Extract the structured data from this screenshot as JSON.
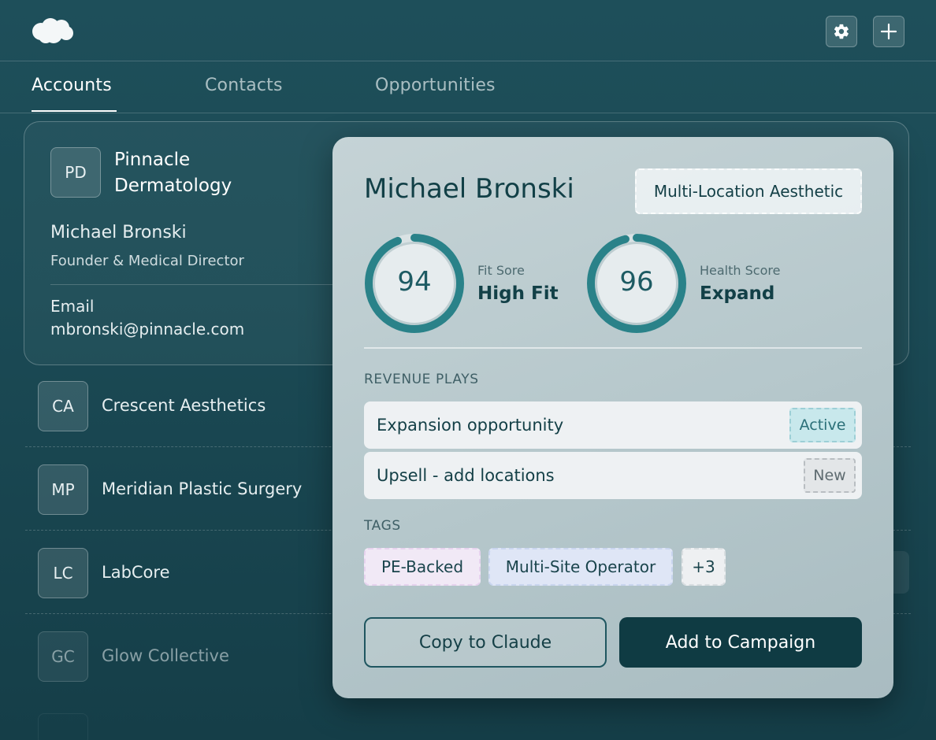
{
  "header": {
    "settings_icon": "gear-icon",
    "add_icon": "plus-icon",
    "logo_icon": "cloud-logo-icon"
  },
  "tabs": [
    {
      "label": "Accounts",
      "active": true
    },
    {
      "label": "Contacts",
      "active": false
    },
    {
      "label": "Opportunities",
      "active": false
    }
  ],
  "selected_account": {
    "initials": "PD",
    "name_line1": "Pinnacle",
    "name_line2": "Dermatology",
    "contact_name": "Michael Bronski",
    "contact_title": "Founder & Medical Director",
    "email_label": "Email",
    "email_value": "mbronski@pinnacle.com"
  },
  "accounts": [
    {
      "initials": "CA",
      "name": "Crescent Aesthetics"
    },
    {
      "initials": "MP",
      "name": "Meridian Plastic Surgery"
    },
    {
      "initials": "LC",
      "name": "LabCore"
    },
    {
      "initials": "GC",
      "name": "Glow Collective"
    }
  ],
  "popup": {
    "name": "Michael Bronski",
    "segment": "Multi-Location Aesthetic",
    "fit": {
      "value": "94",
      "label": "Fit Sore",
      "verdict": "High Fit",
      "percent": 94
    },
    "health": {
      "value": "96",
      "label": "Health Score",
      "verdict": "Expand",
      "percent": 96
    },
    "revenue_title": "REVENUE PLAYS",
    "plays": [
      {
        "label": "Expansion opportunity",
        "status": "Active"
      },
      {
        "label": "Upsell - add locations",
        "status": "New"
      }
    ],
    "tags_title": "TAGS",
    "tags": [
      "PE-Backed",
      "Multi-Site Operator",
      "+3"
    ],
    "copy_button": "Copy to Claude",
    "add_button": "Add to Campaign"
  },
  "colors": {
    "accent": "#2a8289",
    "dark": "#0f3b43",
    "background": "#1e4f5a"
  }
}
